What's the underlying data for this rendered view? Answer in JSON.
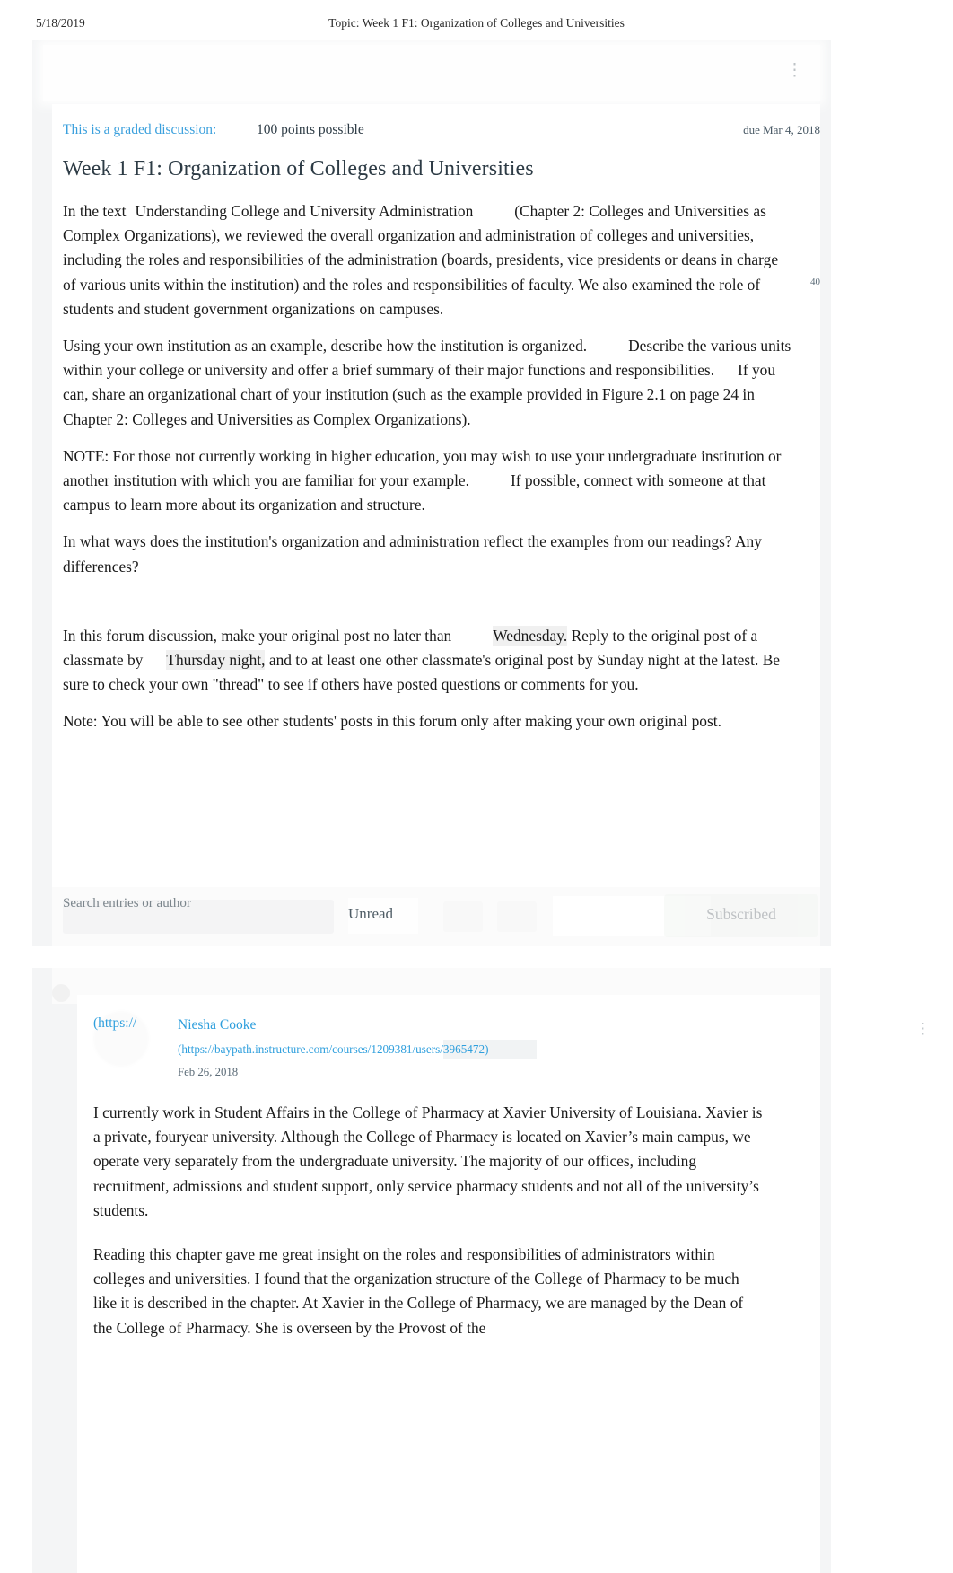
{
  "print_header": {
    "date": "5/18/2019",
    "title": "Topic: Week 1 F1: Organization of Colleges and Universities"
  },
  "toolbar_top": {
    "menu_icon": "kebab-menu-icon"
  },
  "discussion": {
    "graded_label": "This is a graded discussion:",
    "points": "100 points possible",
    "due": "due Mar 4, 2018",
    "reply_count": "40",
    "title": "Week 1 F1: Organization of Colleges and Universities",
    "paragraphs": {
      "p1_a": "In the text",
      "p1_b": "Understanding College and University Administration",
      "p1_c": "(Chapter 2: Colleges and Universities as Complex Organizations), we reviewed the overall organization and administration of colleges and universities, including the roles and responsibilities of the administration (boards, presidents, vice presidents or deans in charge of various units within the institution) and the roles and responsibilities of faculty. We also examined the role of students and student government organizations on campuses.",
      "p2_a": "Using your own institution as an example, describe how the institution is organized.",
      "p2_b": "Describe the various units within your college or university and offer a brief summary of their major functions and responsibilities.",
      "p2_c": "If you can, share an organizational chart of your institution (such as the example provided in Figure 2.1 on page 24 in Chapter 2: Colleges and Universities as Complex Organizations).",
      "p3_a": "NOTE: For those not currently working in higher education, you may wish to use your undergraduate institution or another institution with which you are familiar for your example.",
      "p3_b": "If possible, connect with someone at that campus to learn more about its organization and structure.",
      "p4": "In what ways does the institution's organization and administration reflect the examples from our readings? Any differences?",
      "p5_a": "In this forum discussion, make your original post no later than",
      "p5_b": "Wednesday.",
      "p5_c": "Reply to the original post of a classmate by",
      "p5_d": "Thursday night,",
      "p5_e": "and to at least one other classmate's original post by Sunday night at the latest. Be sure to check your own \"thread\" to see if others have posted questions or comments for you.",
      "p6": "Note: You will be able to see other students' posts in this forum only after making your own original post."
    }
  },
  "filter_bar": {
    "search_placeholder": "Search entries or author",
    "unread_label": "Unread",
    "subscribed_label": "Subscribed"
  },
  "entry": {
    "avatar_link_text": "(https://",
    "author": "Niesha Cooke",
    "author_url": "(https://baypath.instructure.com/courses/1209381/users/3965472)",
    "date": "Feb 26, 2018",
    "menu_icon": "kebab-menu-icon",
    "paragraphs": [
      "I currently work in Student Affairs in the College of Pharmacy at Xavier University of Louisiana. Xavier is a private, fouryear university. Although the College of Pharmacy is located on Xavier’s main campus, we operate very separately from the undergraduate university. The majority of our offices, including recruitment, admissions and student support, only service pharmacy students and not all of the university’s students.",
      "Reading this chapter gave me great insight on the roles and responsibilities of administrators within colleges and universities. I found that the organization structure of the College of Pharmacy to be much like it is described in the chapter. At Xavier in the College of Pharmacy, we are managed by the Dean of the College of Pharmacy. She is overseen by the Provost of the"
    ]
  },
  "colors": {
    "link_blue": "#2f9fdd",
    "graded_blue": "#3ba0dd",
    "text": "#1a1a1a",
    "page_bg": "#f4f5f6"
  }
}
